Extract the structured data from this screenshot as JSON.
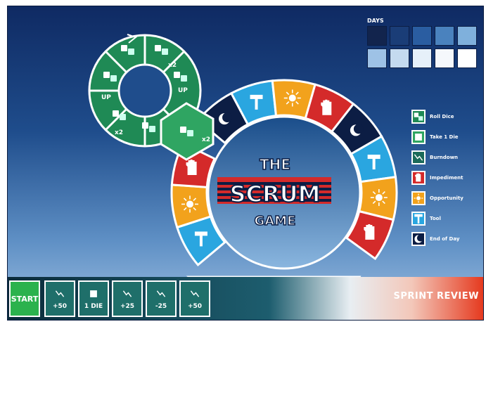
{
  "title": {
    "line1": "THE",
    "line2": "SCRUM",
    "line3": "GAME"
  },
  "days": {
    "label": "DAYS",
    "cells": [
      "#12244d",
      "#1a3d77",
      "#2a5da1",
      "#4a82be",
      "#7fb0dc",
      "#9ec2e6",
      "#c4daef",
      "#e6f0f9",
      "#f5f8fc",
      "#ffffff"
    ]
  },
  "legend": {
    "items": [
      {
        "label": "Roll Dice",
        "icon": "two-dice-icon",
        "color": "#1f8a55"
      },
      {
        "label": "Take 1 Die",
        "icon": "single-die-icon",
        "color": "#2fa562"
      },
      {
        "label": "Burndown",
        "icon": "burndown-icon",
        "color": "#1b6a5a"
      },
      {
        "label": "Impediment",
        "icon": "hand-icon",
        "color": "#d42a2a"
      },
      {
        "label": "Opportunity",
        "icon": "sun-icon",
        "color": "#f2a21c"
      },
      {
        "label": "Tool",
        "icon": "hammer-icon",
        "color": "#2aa6e0"
      },
      {
        "label": "End of Day",
        "icon": "moon-icon",
        "color": "#0c1d44"
      }
    ]
  },
  "dice_wheel": {
    "labels": [
      "x2",
      "UP",
      "UP",
      "x2"
    ],
    "entry_label": "x2"
  },
  "track": {
    "start": "START",
    "cells": [
      "+50",
      "1 DIE",
      "+25",
      "-25",
      "+50"
    ],
    "end": "SPRINT REVIEW"
  },
  "colors": {
    "tool": "#2aa6e0",
    "opportunity": "#f2a21c",
    "impediment": "#d42a2a",
    "end_of_day": "#0c1d44",
    "dice_green": "#2fa562"
  }
}
